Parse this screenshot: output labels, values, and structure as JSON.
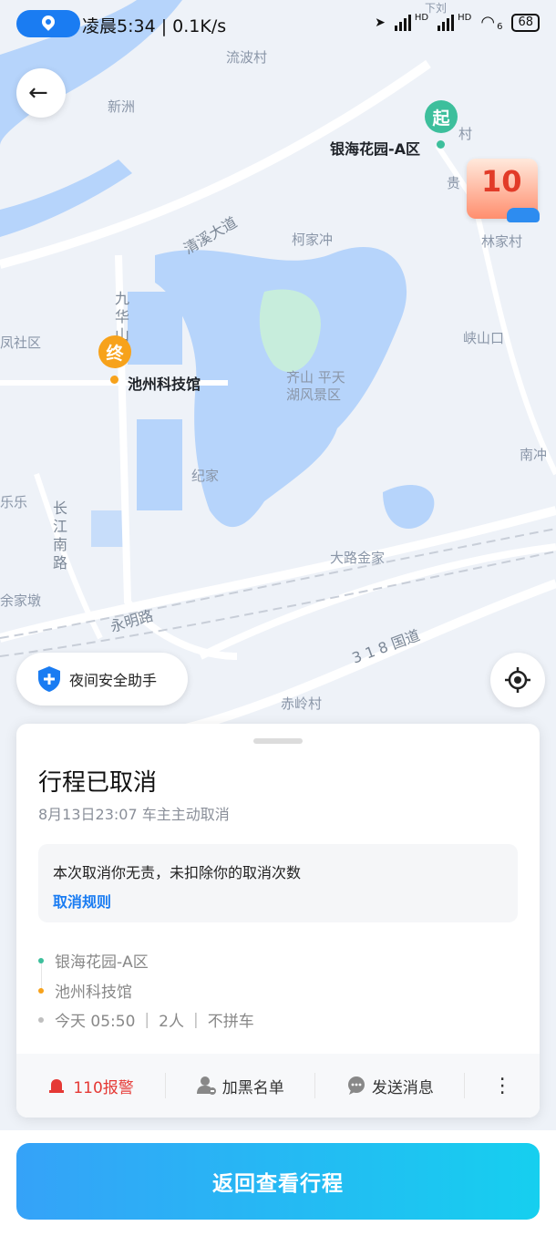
{
  "status_bar": {
    "time": "凌晨5:34 | 0.1K/s",
    "hd1": "HD",
    "hd2": "HD",
    "wifi": "6",
    "battery": "68"
  },
  "map": {
    "labels": {
      "liubo": "流波村",
      "xinzhou": "新洲",
      "qingxi": "清溪大道",
      "kejia": "柯家冲",
      "linjia": "林家村",
      "xiashan": "峡山口",
      "fengshe": "凤社区",
      "jiuhua": "九华山",
      "qishan": "齐山 平天",
      "huanfeng": "湖风景区",
      "jijia": "纪家",
      "nanchong": "南冲",
      "lele": "乐乐",
      "changjiang": "长江南路",
      "dalu": "大路金家",
      "yujiadun": "余家墩",
      "yongming": "永明路",
      "guodao": "3 1 8 国道",
      "chiling": "赤岭村",
      "gui": "贵",
      "xiacun": "下刘",
      "cun": "村"
    },
    "start_marker": "起",
    "start_name": "银海花园-A区",
    "end_marker": "终",
    "end_name": "池州科技馆",
    "promo_amount": "10",
    "colors": {
      "water": "#b6d4fb",
      "green": "#c7eddc",
      "road": "#ffffff"
    }
  },
  "safety_button": {
    "label": "夜间安全助手",
    "icon": "shield-plus-icon"
  },
  "locate_button": {
    "icon": "crosshair-icon"
  },
  "card": {
    "title": "行程已取消",
    "subtitle": "8月13日23:07  车主主动取消",
    "notice": "本次取消你无责，未扣除你的取消次数",
    "notice_link": "取消规则",
    "from": "银海花园-A区",
    "to": "池州科技馆",
    "meta": {
      "time": "今天 05:50",
      "people": "2人",
      "pool": "不拼车"
    },
    "actions": [
      {
        "label": "110报警",
        "icon": "alarm-icon",
        "color": "#e53935"
      },
      {
        "label": "加黑名单",
        "icon": "user-block-icon"
      },
      {
        "label": "发送消息",
        "icon": "message-icon"
      },
      {
        "label": "⋮",
        "icon": "more-icon"
      }
    ]
  },
  "primary_button": {
    "label": "返回查看行程",
    "colors": [
      "#35a2f8",
      "#16cfef"
    ]
  }
}
